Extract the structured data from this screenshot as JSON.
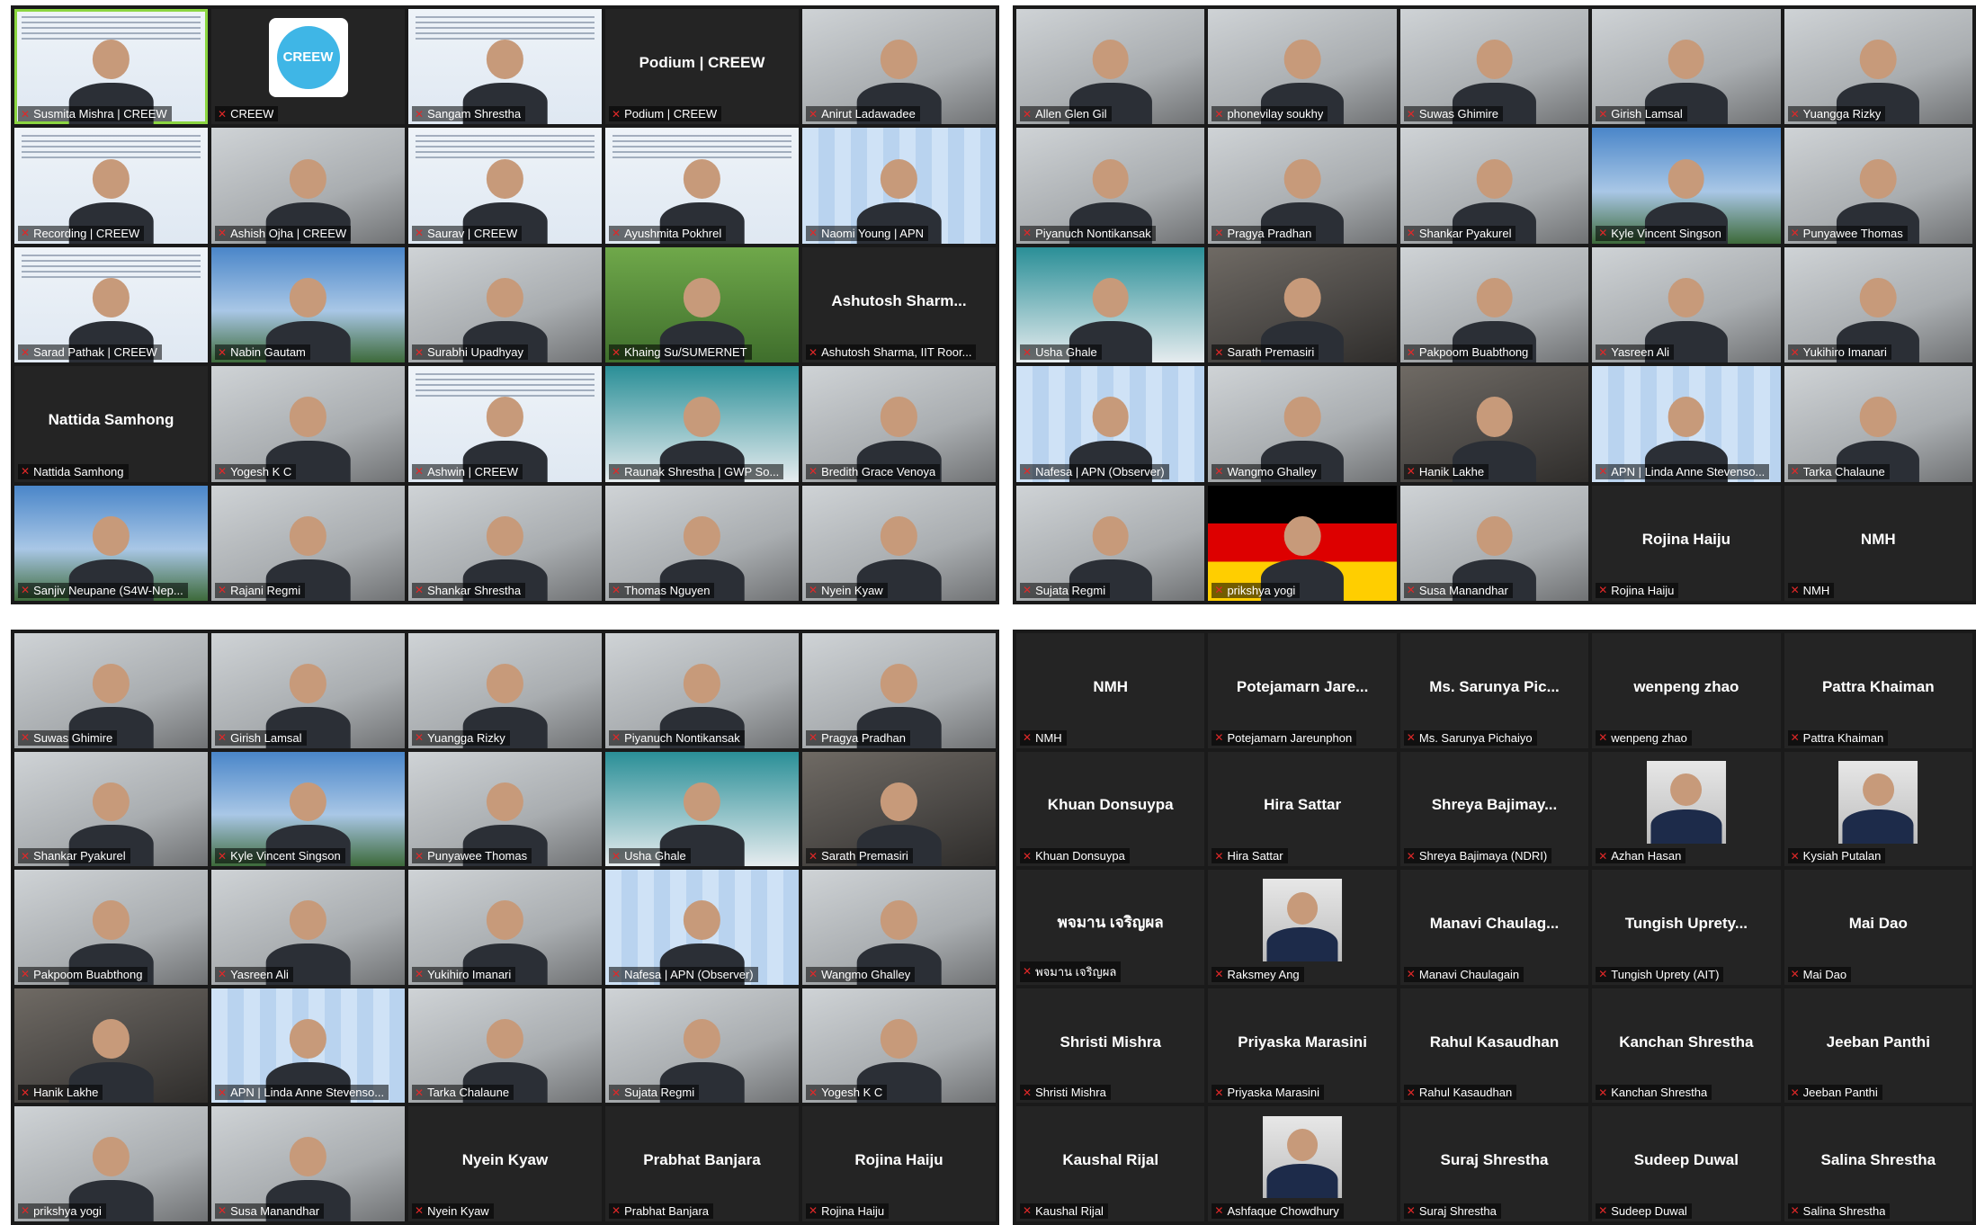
{
  "panels": [
    {
      "tiles": [
        {
          "name": "Susmita Mishra | CREEW",
          "type": "video",
          "style": "slide",
          "active": true
        },
        {
          "name": "CREEW",
          "type": "logo",
          "logo_text": "CREEW"
        },
        {
          "name": "Sangam Shrestha",
          "type": "video",
          "style": "slide"
        },
        {
          "name": "Podium | CREEW",
          "type": "avatar",
          "center": "Podium | CREEW"
        },
        {
          "name": "Anirut Ladawadee",
          "type": "video",
          "style": "light"
        },
        {
          "name": "Recording | CREEW",
          "type": "video",
          "style": "slide"
        },
        {
          "name": "Ashish Ojha | CREEW",
          "type": "video",
          "style": "light"
        },
        {
          "name": "Saurav | CREEW",
          "type": "video",
          "style": "slide"
        },
        {
          "name": "Ayushmita Pokhrel",
          "type": "video",
          "style": "slide"
        },
        {
          "name": "Naomi Young | APN",
          "type": "video",
          "style": "blue"
        },
        {
          "name": "Sarad Pathak | CREEW",
          "type": "video",
          "style": "slide"
        },
        {
          "name": "Nabin Gautam",
          "type": "video",
          "style": "sky"
        },
        {
          "name": "Surabhi Upadhyay",
          "type": "video",
          "style": "light"
        },
        {
          "name": "Khaing Su/SUMERNET",
          "type": "video",
          "style": "green"
        },
        {
          "name": "Ashutosh Sharma, IIT Roor...",
          "type": "avatar",
          "center": "Ashutosh Sharm..."
        },
        {
          "name": "Nattida Samhong",
          "type": "avatar",
          "center": "Nattida Samhong"
        },
        {
          "name": "Yogesh K C",
          "type": "video",
          "style": "light"
        },
        {
          "name": "Ashwin | CREEW",
          "type": "video",
          "style": "slide"
        },
        {
          "name": "Raunak Shrestha | GWP So...",
          "type": "video",
          "style": "teal"
        },
        {
          "name": "Bredith Grace Venoya",
          "type": "video",
          "style": "light"
        },
        {
          "name": "Sanjiv Neupane (S4W-Nep...",
          "type": "video",
          "style": "sky"
        },
        {
          "name": "Rajani Regmi",
          "type": "video",
          "style": "light"
        },
        {
          "name": "Shankar Shrestha",
          "type": "video",
          "style": "light"
        },
        {
          "name": "Thomas Nguyen",
          "type": "video",
          "style": "light"
        },
        {
          "name": "Nyein Kyaw",
          "type": "video",
          "style": "light"
        }
      ]
    },
    {
      "tiles": [
        {
          "name": "Allen Glen Gil",
          "type": "video",
          "style": "light"
        },
        {
          "name": "phonevilay soukhy",
          "type": "video",
          "style": "light"
        },
        {
          "name": "Suwas Ghimire",
          "type": "video",
          "style": "light"
        },
        {
          "name": "Girish Lamsal",
          "type": "video",
          "style": "light"
        },
        {
          "name": "Yuangga Rizky",
          "type": "video",
          "style": "light"
        },
        {
          "name": "Piyanuch Nontikansak",
          "type": "video",
          "style": "light"
        },
        {
          "name": "Pragya Pradhan",
          "type": "video",
          "style": "light"
        },
        {
          "name": "Shankar Pyakurel",
          "type": "video",
          "style": "light"
        },
        {
          "name": "Kyle Vincent Singson",
          "type": "video",
          "style": "sky"
        },
        {
          "name": "Punyawee Thomas",
          "type": "video",
          "style": "light"
        },
        {
          "name": "Usha Ghale",
          "type": "video",
          "style": "teal"
        },
        {
          "name": "Sarath Premasiri",
          "type": "video",
          "style": "video"
        },
        {
          "name": "Pakpoom Buabthong",
          "type": "video",
          "style": "light"
        },
        {
          "name": "Yasreen Ali",
          "type": "video",
          "style": "light"
        },
        {
          "name": "Yukihiro Imanari",
          "type": "video",
          "style": "light"
        },
        {
          "name": "Nafesa | APN (Observer)",
          "type": "video",
          "style": "blue"
        },
        {
          "name": "Wangmo Ghalley",
          "type": "video",
          "style": "light"
        },
        {
          "name": "Hanik Lakhe",
          "type": "video",
          "style": "video"
        },
        {
          "name": "APN | Linda Anne Stevenso...",
          "type": "video",
          "style": "blue"
        },
        {
          "name": "Tarka Chalaune",
          "type": "video",
          "style": "light"
        },
        {
          "name": "Sujata Regmi",
          "type": "video",
          "style": "light"
        },
        {
          "name": "prikshya yogi",
          "type": "video",
          "style": "flag"
        },
        {
          "name": "Susa Manandhar",
          "type": "video",
          "style": "light"
        },
        {
          "name": "Rojina Haiju",
          "type": "avatar",
          "center": "Rojina Haiju"
        },
        {
          "name": "NMH",
          "type": "avatar",
          "center": "NMH"
        }
      ]
    },
    {
      "tiles": [
        {
          "name": "Suwas Ghimire",
          "type": "video",
          "style": "light"
        },
        {
          "name": "Girish Lamsal",
          "type": "video",
          "style": "light"
        },
        {
          "name": "Yuangga Rizky",
          "type": "video",
          "style": "light"
        },
        {
          "name": "Piyanuch Nontikansak",
          "type": "video",
          "style": "light"
        },
        {
          "name": "Pragya Pradhan",
          "type": "video",
          "style": "light"
        },
        {
          "name": "Shankar Pyakurel",
          "type": "video",
          "style": "light"
        },
        {
          "name": "Kyle Vincent Singson",
          "type": "video",
          "style": "sky"
        },
        {
          "name": "Punyawee Thomas",
          "type": "video",
          "style": "light"
        },
        {
          "name": "Usha Ghale",
          "type": "video",
          "style": "teal"
        },
        {
          "name": "Sarath Premasiri",
          "type": "video",
          "style": "video"
        },
        {
          "name": "Pakpoom Buabthong",
          "type": "video",
          "style": "light"
        },
        {
          "name": "Yasreen Ali",
          "type": "video",
          "style": "light"
        },
        {
          "name": "Yukihiro Imanari",
          "type": "video",
          "style": "light"
        },
        {
          "name": "Nafesa | APN (Observer)",
          "type": "video",
          "style": "blue"
        },
        {
          "name": "Wangmo Ghalley",
          "type": "video",
          "style": "light"
        },
        {
          "name": "Hanik Lakhe",
          "type": "video",
          "style": "video"
        },
        {
          "name": "APN | Linda Anne Stevenso...",
          "type": "video",
          "style": "blue"
        },
        {
          "name": "Tarka Chalaune",
          "type": "video",
          "style": "light"
        },
        {
          "name": "Sujata Regmi",
          "type": "video",
          "style": "light"
        },
        {
          "name": "Yogesh K C",
          "type": "video",
          "style": "light"
        },
        {
          "name": "prikshya yogi",
          "type": "video",
          "style": "light"
        },
        {
          "name": "Susa Manandhar",
          "type": "video",
          "style": "light"
        },
        {
          "name": "Nyein Kyaw",
          "type": "avatar",
          "center": "Nyein Kyaw"
        },
        {
          "name": "Prabhat Banjara",
          "type": "avatar",
          "center": "Prabhat Banjara"
        },
        {
          "name": "Rojina Haiju",
          "type": "avatar",
          "center": "Rojina Haiju"
        }
      ]
    },
    {
      "tiles": [
        {
          "name": "NMH",
          "type": "avatar",
          "center": "NMH"
        },
        {
          "name": "Potejamarn Jareunphon",
          "type": "avatar",
          "center": "Potejamarn Jare..."
        },
        {
          "name": "Ms. Sarunya Pichaiyo",
          "type": "avatar",
          "center": "Ms. Sarunya Pic..."
        },
        {
          "name": "wenpeng zhao",
          "type": "avatar",
          "center": "wenpeng zhao"
        },
        {
          "name": "Pattra Khaiman",
          "type": "avatar",
          "center": "Pattra Khaiman"
        },
        {
          "name": "Khuan Donsuypa",
          "type": "avatar",
          "center": "Khuan Donsuypa"
        },
        {
          "name": "Hira Sattar",
          "type": "avatar",
          "center": "Hira Sattar"
        },
        {
          "name": "Shreya Bajimaya (NDRI)",
          "type": "avatar",
          "center": "Shreya Bajimay..."
        },
        {
          "name": "Azhan Hasan",
          "type": "photo"
        },
        {
          "name": "Kysiah Putalan",
          "type": "photo"
        },
        {
          "name": "พจมาน เจริญผล",
          "type": "avatar",
          "center": "พจมาน เจริญผล"
        },
        {
          "name": "Raksmey Ang",
          "type": "photo"
        },
        {
          "name": "Manavi Chaulagain",
          "type": "avatar",
          "center": "Manavi Chaulag..."
        },
        {
          "name": "Tungish Uprety (AIT)",
          "type": "avatar",
          "center": "Tungish Uprety..."
        },
        {
          "name": "Mai Dao",
          "type": "avatar",
          "center": "Mai Dao"
        },
        {
          "name": "Shristi Mishra",
          "type": "avatar",
          "center": "Shristi Mishra"
        },
        {
          "name": "Priyaska Marasini",
          "type": "avatar",
          "center": "Priyaska Marasini"
        },
        {
          "name": "Rahul Kasaudhan",
          "type": "avatar",
          "center": "Rahul Kasaudhan"
        },
        {
          "name": "Kanchan Shrestha",
          "type": "avatar",
          "center": "Kanchan Shrestha"
        },
        {
          "name": "Jeeban Panthi",
          "type": "avatar",
          "center": "Jeeban Panthi"
        },
        {
          "name": "Kaushal Rijal",
          "type": "avatar",
          "center": "Kaushal Rijal"
        },
        {
          "name": "Ashfaque Chowdhury",
          "type": "photo"
        },
        {
          "name": "Suraj Shrestha",
          "type": "avatar",
          "center": "Suraj Shrestha"
        },
        {
          "name": "Sudeep Duwal",
          "type": "avatar",
          "center": "Sudeep Duwal"
        },
        {
          "name": "Salina Shrestha",
          "type": "avatar",
          "center": "Salina Shrestha"
        }
      ]
    }
  ],
  "icons": {
    "muted": "mic-muted-icon"
  },
  "colors": {
    "panel_bg": "#1a1a1a",
    "tile_bg": "#242424",
    "muted_icon": "#e02828",
    "active_speaker": "#8bd641"
  }
}
